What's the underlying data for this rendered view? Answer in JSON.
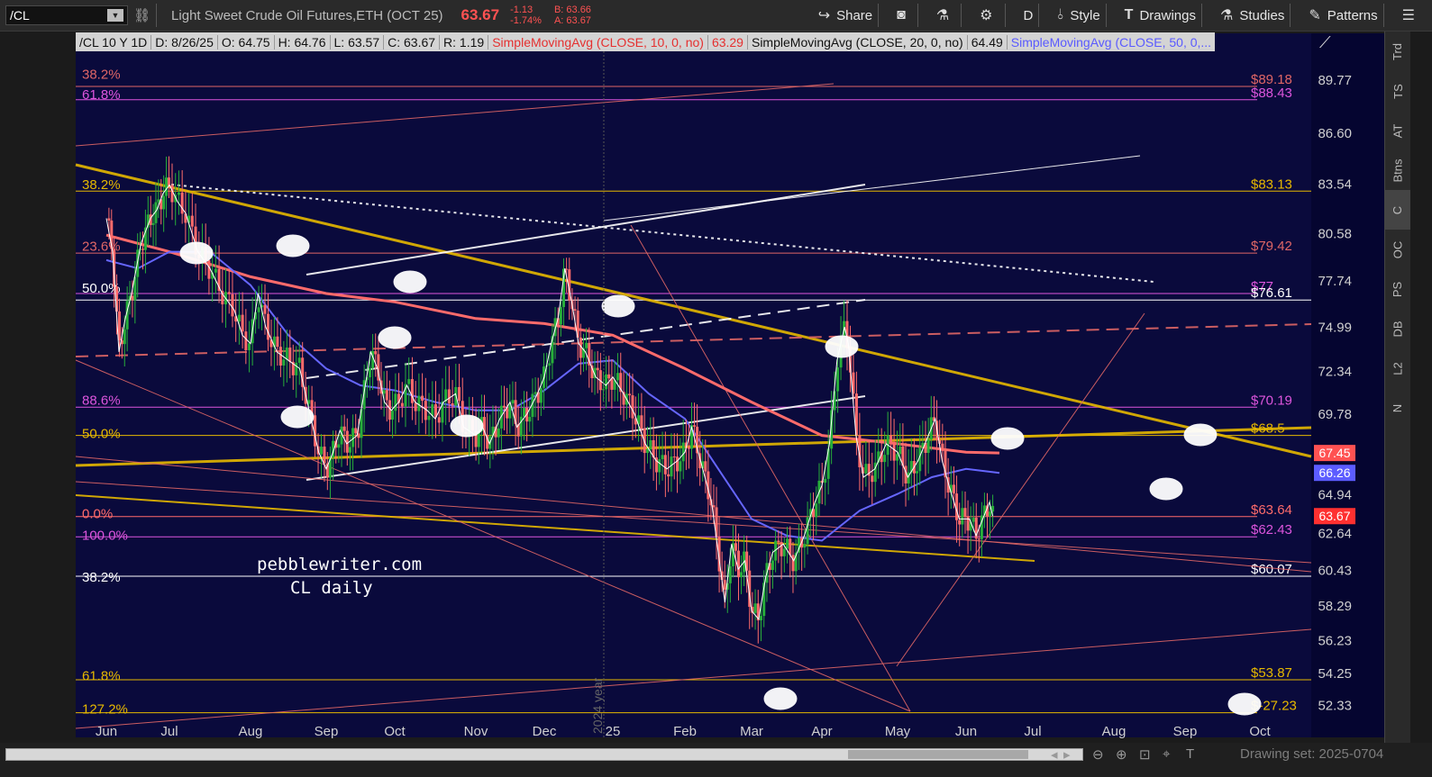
{
  "toolbar": {
    "symbol": "/CL",
    "instrument": "Light Sweet Crude Oil Futures,ETH (OCT 25)",
    "last": "63.67",
    "change": "-1.13",
    "change_pct": "-1.74%",
    "bid": "B: 63.66",
    "ask": "A: 63.67",
    "share": "Share",
    "timeframe": "D",
    "style": "Style",
    "drawings": "Drawings",
    "studies": "Studies",
    "patterns": "Patterns"
  },
  "header": {
    "period": "/CL 10 Y 1D",
    "date": "D: 8/26/25",
    "open": "O: 64.75",
    "high": "H: 64.76",
    "low": "L: 63.57",
    "close": "C: 63.67",
    "range": "R: 1.19",
    "sma10_label": "SimpleMovingAvg (CLOSE, 10, 0, no)",
    "sma10_val": "63.29",
    "sma20_label": "SimpleMovingAvg (CLOSE, 20, 0, no)",
    "sma20_val": "64.49",
    "sma50_label": "SimpleMovingAvg (CLOSE, 50, 0,..."
  },
  "right_tabs": [
    "Trd",
    "TS",
    "AT",
    "Btns",
    "C",
    "OC",
    "PS",
    "DB",
    "L2",
    "N"
  ],
  "bottom": {
    "drawing_set": "Drawing set: 2025-0704"
  },
  "colors": {
    "bg": "#0a0a3c",
    "up": "#27ae3a",
    "down": "#ff6b6b",
    "yellow": "#e6b800",
    "magenta": "#dd55dd",
    "sma10": "#e03030",
    "sma20": "#ffffff",
    "sma50": "#6666ff",
    "sma200": "#ff6b6b",
    "gold_ma": "#c9b033"
  },
  "chart_data": {
    "type": "candlestick",
    "watermark": "pebblewriter.com\nCL daily",
    "watermark_line1": "pebblewriter.com",
    "watermark_line2": "CL daily",
    "year_marker": "2024 year",
    "x_ticks": [
      "Jun",
      "Jul",
      "Aug",
      "Sep",
      "Oct",
      "Nov",
      "Dec",
      "25",
      "Feb",
      "Mar",
      "Apr",
      "May",
      "Jun",
      "Jul",
      "Aug",
      "Sep",
      "Oct"
    ],
    "y_ticks": [
      89.77,
      86.6,
      83.54,
      80.58,
      77.74,
      74.99,
      72.34,
      69.78,
      67.3,
      64.94,
      62.64,
      60.43,
      58.29,
      56.23,
      54.25,
      52.33
    ],
    "ylim": [
      51.5,
      91.5
    ],
    "badges": [
      {
        "label": "67.45",
        "color": "#ff5252",
        "y": 67.45
      },
      {
        "label": "66.26",
        "color": "#5c5cff",
        "y": 66.26
      },
      {
        "label": "63.67",
        "color": "#ff3030",
        "y": 63.67
      }
    ],
    "fib_left_labels": [
      {
        "label": "38.2%",
        "y": 89.9,
        "color": "#e06666"
      },
      {
        "label": "61.8%",
        "y": 88.7,
        "color": "#dd55dd"
      },
      {
        "label": "38.2%",
        "y": 83.3,
        "color": "#e6b800"
      },
      {
        "label": "23.6%",
        "y": 79.6,
        "color": "#e06666"
      },
      {
        "label": "50.0%",
        "y": 77.1,
        "color": "#ffffff"
      },
      {
        "label": "88.6%",
        "y": 70.4,
        "color": "#dd55dd"
      },
      {
        "label": "50.0%",
        "y": 68.4,
        "color": "#e6b800"
      },
      {
        "label": "0.0%",
        "y": 63.6,
        "color": "#ff6b6b"
      },
      {
        "label": "100.0%",
        "y": 62.3,
        "color": "#dd55dd"
      },
      {
        "label": "38.2%",
        "y": 59.8,
        "color": "#ffffff"
      },
      {
        "label": "61.8%",
        "y": 53.9,
        "color": "#e6b800"
      },
      {
        "label": "127.2%",
        "y": 51.9,
        "color": "#e6b800"
      }
    ],
    "price_levels": [
      {
        "label": "$89.18",
        "y": 89.4,
        "color": "#e06666"
      },
      {
        "label": "$88.43",
        "y": 88.6,
        "color": "#dd55dd"
      },
      {
        "label": "$83.13",
        "y": 83.13,
        "color": "#e6b800"
      },
      {
        "label": "$79.42",
        "y": 79.42,
        "color": "#e06666"
      },
      {
        "label": "$77",
        "y": 77.0,
        "color": "#dd55dd"
      },
      {
        "label": "$76.61",
        "y": 76.61,
        "color": "#ffffff"
      },
      {
        "label": "$70.19",
        "y": 70.19,
        "color": "#dd55dd"
      },
      {
        "label": "$68.5",
        "y": 68.5,
        "color": "#e6b800"
      },
      {
        "label": "$63.64",
        "y": 63.64,
        "color": "#ff6b6b"
      },
      {
        "label": "$62.43",
        "y": 62.43,
        "color": "#dd55dd"
      },
      {
        "label": "$60.07",
        "y": 60.07,
        "color": "#ffffff"
      },
      {
        "label": "$53.87",
        "y": 53.87,
        "color": "#e6b800"
      },
      {
        "label": "$-27.23",
        "y": 51.9,
        "color": "#e6b800"
      }
    ],
    "close_series": [
      [
        0,
        81.5
      ],
      [
        0.1,
        79.5
      ],
      [
        0.2,
        73.5
      ],
      [
        0.3,
        75.5
      ],
      [
        0.4,
        77.0
      ],
      [
        0.55,
        80.0
      ],
      [
        0.7,
        81.5
      ],
      [
        0.8,
        82.0
      ],
      [
        0.9,
        83.0
      ],
      [
        1.0,
        83.5
      ],
      [
        1.1,
        82.5
      ],
      [
        1.2,
        81.8
      ],
      [
        1.35,
        79.5
      ],
      [
        1.5,
        78.5
      ],
      [
        1.65,
        77.0
      ],
      [
        1.8,
        76.0
      ],
      [
        1.9,
        74.5
      ],
      [
        2.0,
        74.0
      ],
      [
        2.1,
        77.0
      ],
      [
        2.2,
        75.0
      ],
      [
        2.35,
        73.5
      ],
      [
        2.5,
        73.0
      ],
      [
        2.65,
        72.5
      ],
      [
        2.8,
        69.5
      ],
      [
        2.9,
        67.5
      ],
      [
        3.0,
        66.5
      ],
      [
        3.1,
        67.5
      ],
      [
        3.2,
        68.8
      ],
      [
        3.3,
        68.0
      ],
      [
        3.45,
        68.5
      ],
      [
        3.55,
        71.0
      ],
      [
        3.65,
        73.5
      ],
      [
        3.75,
        72.5
      ],
      [
        3.85,
        70.5
      ],
      [
        3.95,
        70.0
      ],
      [
        4.05,
        70.5
      ],
      [
        4.15,
        71.5
      ],
      [
        4.25,
        70.5
      ],
      [
        4.4,
        70.0
      ],
      [
        4.5,
        69.5
      ],
      [
        4.6,
        70.5
      ],
      [
        4.75,
        71.0
      ],
      [
        4.85,
        69.0
      ],
      [
        5.0,
        68.5
      ],
      [
        5.1,
        69.0
      ],
      [
        5.2,
        68.0
      ],
      [
        5.35,
        69.5
      ],
      [
        5.5,
        70.5
      ],
      [
        5.6,
        69.0
      ],
      [
        5.75,
        69.8
      ],
      [
        5.9,
        71.0
      ],
      [
        6.0,
        72.0
      ],
      [
        6.1,
        74.0
      ],
      [
        6.2,
        75.5
      ],
      [
        6.3,
        78.5
      ],
      [
        6.4,
        76.5
      ],
      [
        6.5,
        74.0
      ],
      [
        6.6,
        73.5
      ],
      [
        6.75,
        72.0
      ],
      [
        6.9,
        71.5
      ],
      [
        7.0,
        72.0
      ],
      [
        7.15,
        71.0
      ],
      [
        7.3,
        69.8
      ],
      [
        7.45,
        68.0
      ],
      [
        7.6,
        67.0
      ],
      [
        7.75,
        66.5
      ],
      [
        7.9,
        67.0
      ],
      [
        8.0,
        67.5
      ],
      [
        8.1,
        69.0
      ],
      [
        8.2,
        67.5
      ],
      [
        8.3,
        66.0
      ],
      [
        8.4,
        64.5
      ],
      [
        8.5,
        61.5
      ],
      [
        8.6,
        58.5
      ],
      [
        8.7,
        62.0
      ],
      [
        8.8,
        60.5
      ],
      [
        8.9,
        61.0
      ],
      [
        9.0,
        58.0
      ],
      [
        9.1,
        57.5
      ],
      [
        9.2,
        60.0
      ],
      [
        9.3,
        61.5
      ],
      [
        9.45,
        62.0
      ],
      [
        9.6,
        61.0
      ],
      [
        9.75,
        62.5
      ],
      [
        9.9,
        64.5
      ],
      [
        10.0,
        65.5
      ],
      [
        10.1,
        68.0
      ],
      [
        10.2,
        73.0
      ],
      [
        10.3,
        75.0
      ],
      [
        10.35,
        74.0
      ],
      [
        10.45,
        68.5
      ],
      [
        10.55,
        66.0
      ],
      [
        10.7,
        66.5
      ],
      [
        10.85,
        68.0
      ],
      [
        11.0,
        67.5
      ],
      [
        11.15,
        66.0
      ],
      [
        11.3,
        67.0
      ],
      [
        11.45,
        68.5
      ],
      [
        11.55,
        69.5
      ],
      [
        11.65,
        67.0
      ],
      [
        11.75,
        65.5
      ],
      [
        11.9,
        63.5
      ],
      [
        12.05,
        63.5
      ],
      [
        12.15,
        62.5
      ],
      [
        12.25,
        63.5
      ],
      [
        12.35,
        64.5
      ],
      [
        12.4,
        63.67
      ]
    ],
    "sma50_series": [
      [
        0,
        79.0
      ],
      [
        0.5,
        78.5
      ],
      [
        1.0,
        79.5
      ],
      [
        1.5,
        79.5
      ],
      [
        2.0,
        77.5
      ],
      [
        2.5,
        74.5
      ],
      [
        3.0,
        72.5
      ],
      [
        3.5,
        71.5
      ],
      [
        4.0,
        71.2
      ],
      [
        4.5,
        70.5
      ],
      [
        5.0,
        70.0
      ],
      [
        5.5,
        70.0
      ],
      [
        6.0,
        71.2
      ],
      [
        6.5,
        72.8
      ],
      [
        7.0,
        73.0
      ],
      [
        7.5,
        71.0
      ],
      [
        8.0,
        69.5
      ],
      [
        8.5,
        66.5
      ],
      [
        9.0,
        63.5
      ],
      [
        9.5,
        62.5
      ],
      [
        10.0,
        62.2
      ],
      [
        10.5,
        64.0
      ],
      [
        11.0,
        65.0
      ],
      [
        11.5,
        66.0
      ],
      [
        12.0,
        66.5
      ],
      [
        12.5,
        66.26
      ]
    ],
    "sma200_series": [
      [
        0,
        80.5
      ],
      [
        1.0,
        79.5
      ],
      [
        2.0,
        78.0
      ],
      [
        3.0,
        77.0
      ],
      [
        4.0,
        76.5
      ],
      [
        5.0,
        75.5
      ],
      [
        6.0,
        75.2
      ],
      [
        7.0,
        74.5
      ],
      [
        8.0,
        72.5
      ],
      [
        9.0,
        70.5
      ],
      [
        10.0,
        68.5
      ],
      [
        11.0,
        68.0
      ],
      [
        12.0,
        67.5
      ],
      [
        12.5,
        67.45
      ]
    ]
  }
}
